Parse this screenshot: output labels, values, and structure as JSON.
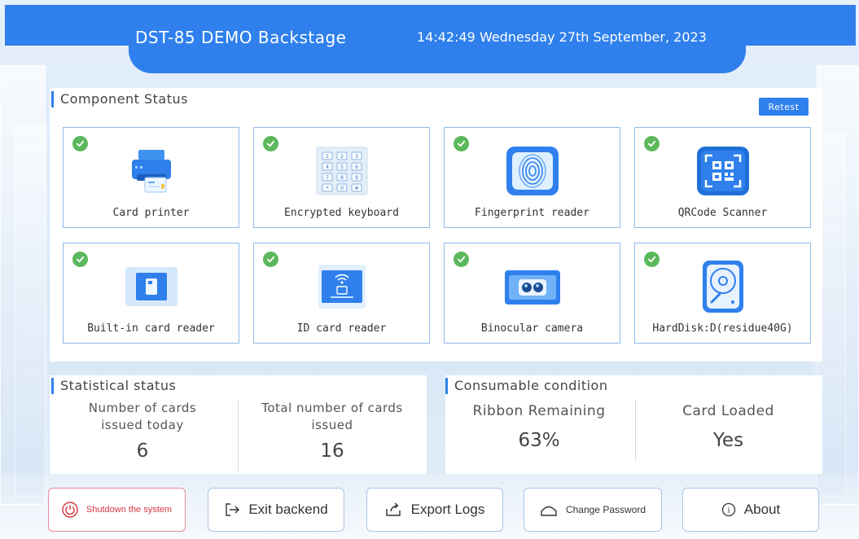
{
  "header": {
    "title": "DST-85 DEMO Backstage",
    "clock": "14:42:49 Wednesday 27th September, 2023",
    "color": "#2f80ec"
  },
  "component_status": {
    "title": "Component Status",
    "retest_label": "Retest",
    "status_icon": "check-circle-icon",
    "status_color": "#5cb85c",
    "devices": [
      {
        "label": "Card printer",
        "icon": "printer-icon",
        "status": "ok"
      },
      {
        "label": "Encrypted keyboard",
        "icon": "keypad-icon",
        "status": "ok"
      },
      {
        "label": "Fingerprint reader",
        "icon": "fingerprint-icon",
        "status": "ok"
      },
      {
        "label": "QRCode Scanner",
        "icon": "qrcode-icon",
        "status": "ok"
      },
      {
        "label": "Built-in card reader",
        "icon": "card-reader-icon",
        "status": "ok"
      },
      {
        "label": "ID card reader",
        "icon": "id-card-reader-icon",
        "status": "ok"
      },
      {
        "label": "Binocular camera",
        "icon": "camera-icon",
        "status": "ok"
      },
      {
        "label": "HardDisk:D(residue40G)",
        "icon": "harddisk-icon",
        "status": "ok"
      }
    ]
  },
  "statistical": {
    "title": "Statistical status",
    "items": [
      {
        "label": "Number of cards issued today",
        "value": "6"
      },
      {
        "label": "Total number of cards issued",
        "value": "16"
      }
    ]
  },
  "consumable": {
    "title": "Consumable condition",
    "items": [
      {
        "label": "Ribbon Remaining",
        "value": "63%"
      },
      {
        "label": "Card Loaded",
        "value": "Yes"
      }
    ]
  },
  "actions": {
    "shutdown": "Shutdown the system",
    "exit": "Exit backend",
    "export": "Export Logs",
    "password": "Change Password",
    "about": "About"
  }
}
